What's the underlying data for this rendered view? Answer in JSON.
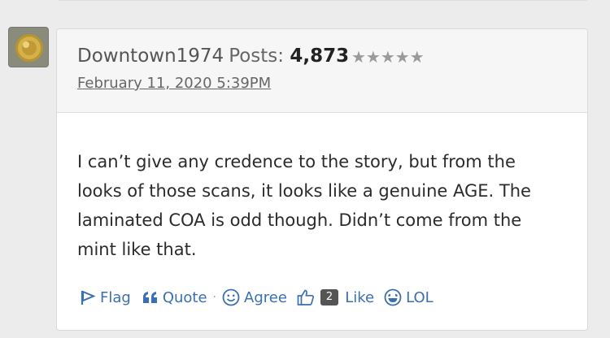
{
  "post": {
    "author": "Downtown1974",
    "posts_label": "Posts:",
    "posts_count": "4,873",
    "rating_stars": "★★★★★",
    "date": "February 11, 2020 5:39PM",
    "body": "I can’t give any credence to the story, but from the looks of those scans, it looks like a genuine AGE. The laminated COA is odd though. Didn’t come from the mint like that."
  },
  "actions": {
    "flag": "Flag",
    "quote": "Quote",
    "separator": "·",
    "agree": "Agree",
    "like_count": "2",
    "like": "Like",
    "lol": "LOL"
  },
  "colors": {
    "link": "#3a6fb0",
    "page_bg": "#ececec",
    "header_bg": "#f6f6f6"
  }
}
